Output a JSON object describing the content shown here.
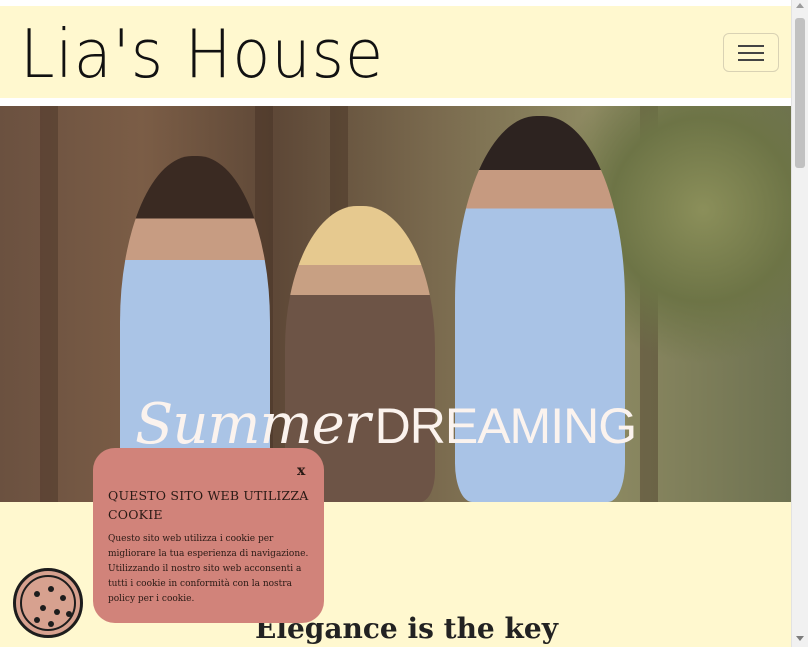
{
  "navbar": {
    "brand": "Lia's House",
    "menu_toggle_icon": "hamburger-menu-icon"
  },
  "hero": {
    "title_script": "Summer",
    "title_caps": "DREAMING"
  },
  "main": {
    "heading": "Elegance is the key"
  },
  "cookie_banner": {
    "close_label": "x",
    "title": "QUESTO SITO WEB UTILIZZA COOKIE",
    "body": "Questo sito web utilizza i cookie per migliorare la tua esperienza di navigazione. Utilizzando il nostro sito web acconsenti a tutti i cookie in conformità con la nostra policy per i cookie.",
    "icon": "cookie-icon"
  },
  "colors": {
    "page_background": "#fff8cf",
    "cookie_panel": "#d1837a",
    "cookie_button": "#d7a18f"
  }
}
